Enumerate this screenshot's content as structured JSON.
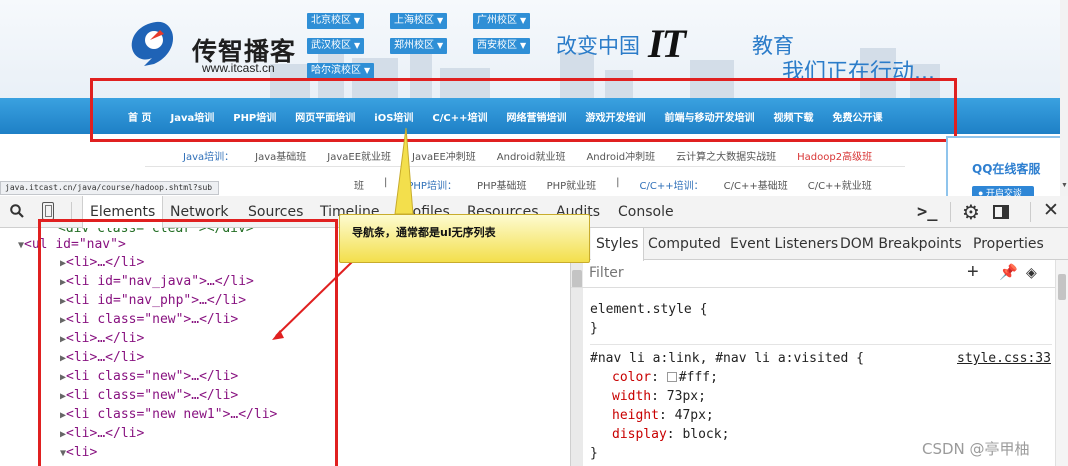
{
  "site": {
    "logo_text": "传智播客",
    "logo_url": "www.itcast.cn",
    "campuses": [
      "北京校区",
      "上海校区",
      "广州校区",
      "武汉校区",
      "郑州校区",
      "西安校区",
      "哈尔滨校区"
    ],
    "slogan_part1": "改变中国",
    "slogan_it": "IT",
    "slogan_part2": "教育",
    "slogan_line2": "我们正在行动...",
    "nav": [
      "首 页",
      "Java培训",
      "PHP培训",
      "网页平面培训",
      "iOS培训",
      "C/C++培训",
      "网络营销培训",
      "游戏开发培训",
      "前端与移动开发培训",
      "视频下载",
      "免费公开课"
    ],
    "subnav_row1": [
      "Java培训：",
      "Java基础班",
      "JavaEE就业班",
      "JavaEE冲刺班",
      "Android就业班",
      "Android冲刺班",
      "云计算之大数据实战班",
      "Hadoop2高级班"
    ],
    "subnav_row2": [
      "班",
      "|",
      "PHP培训：",
      "PHP基础班",
      "PHP就业班",
      "|",
      "C/C++培训：",
      "C/C++基础班",
      "C/C++就业班"
    ],
    "qq_label": "QQ在线客服",
    "qq_button": "● 开启交谈",
    "status_url": "java.itcast.cn/java/course/hadoop.shtml?sub",
    "colors": {
      "nav_bg": "#2a8fd4",
      "highlight": "#e02020",
      "brand_blue": "#2b7cc9"
    }
  },
  "devtools": {
    "tabs": [
      "Elements",
      "Network",
      "Sources",
      "Timeline",
      "Profiles",
      "Resources",
      "Audits",
      "Console"
    ],
    "active_tab": "Elements",
    "dom": {
      "partial": "<div class=\"clear\"></div>",
      "ul_open": "<ul id=\"nav\">",
      "items": [
        "<li>…</li>",
        "<li id=\"nav_java\">…</li>",
        "<li id=\"nav_php\">…</li>",
        "<li class=\"new\">…</li>",
        "<li>…</li>",
        "<li>…</li>",
        "<li class=\"new\">…</li>",
        "<li class=\"new\">…</li>",
        "<li class=\"new new1\">…</li>",
        "<li>…</li>"
      ],
      "last_open": "<li>"
    },
    "styles_tabs": [
      "Styles",
      "Computed",
      "Event Listeners",
      "DOM Breakpoints",
      "Properties"
    ],
    "active_styles_tab": "Styles",
    "filter_placeholder": "Filter",
    "element_style": "element.style {",
    "close_brace": "}",
    "rule_selector": "#nav li a:link, #nav li a:visited {",
    "rule_source": "style.css:33",
    "declarations": [
      {
        "prop": "color",
        "value": "#fff;"
      },
      {
        "prop": "width",
        "value": "73px;"
      },
      {
        "prop": "height",
        "value": "47px;"
      },
      {
        "prop": "display",
        "value": "block;"
      }
    ]
  },
  "callout": {
    "text": "导航条，通常都是ul无序列表"
  },
  "watermark": "CSDN @亭甲柚"
}
